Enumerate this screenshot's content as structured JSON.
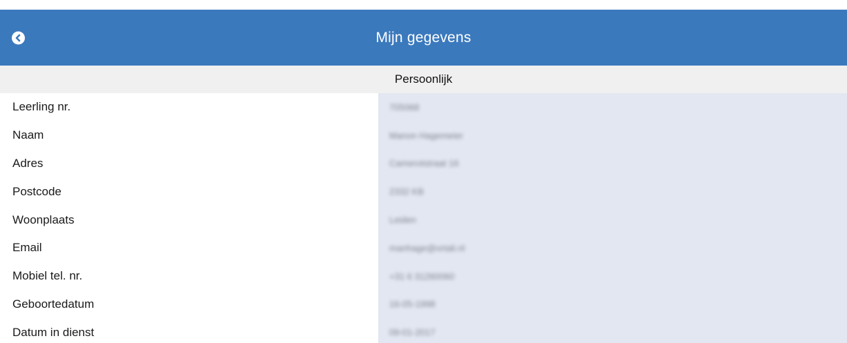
{
  "header": {
    "title": "Mijn gegevens",
    "back_icon": "chevron-left-circle-icon",
    "accent_color": "#3b79bd"
  },
  "section": {
    "title": "Persoonlijk"
  },
  "fields": [
    {
      "label": "Leerling nr.",
      "value": "705068"
    },
    {
      "label": "Naam",
      "value": "Manon Hagemeier"
    },
    {
      "label": "Adres",
      "value": "Camerotstraat 16"
    },
    {
      "label": "Postcode",
      "value": "2332 KB"
    },
    {
      "label": "Woonplaats",
      "value": "Leiden"
    },
    {
      "label": "Email",
      "value": "manhage@ortali.nl"
    },
    {
      "label": "Mobiel tel. nr.",
      "value": "+31 6 31260060"
    },
    {
      "label": "Geboortedatum",
      "value": "16-05-1998"
    },
    {
      "label": "Datum in dienst",
      "value": "09-01-2017"
    }
  ]
}
